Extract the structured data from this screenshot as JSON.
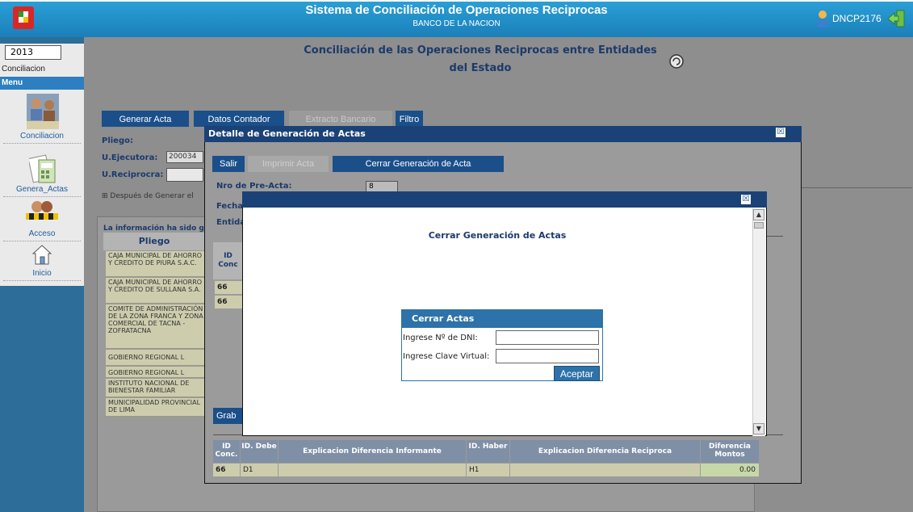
{
  "header": {
    "title": "Sistema de Conciliación de Operaciones Reciprocas",
    "subtitle": "BANCO DE LA NACION",
    "user": "DNCP2176"
  },
  "sidebar": {
    "year": "2013",
    "section": "Conciliacion",
    "menu_label": "Menu",
    "items": [
      {
        "label": "Conciliacion",
        "icon": "meeting-people-icon"
      },
      {
        "label": "Genera_Actas",
        "icon": "document-calculator-icon"
      },
      {
        "label": "Acceso",
        "icon": "restricted-access-icon"
      },
      {
        "label": "Inicio",
        "icon": "home-icon"
      }
    ]
  },
  "main": {
    "title": "Conciliación de las Operaciones Reciprocas entre Entidades del Estado",
    "tabs": [
      "Generar Acta",
      "Datos Contador",
      "Extracto Bancario",
      "Filtro"
    ],
    "pliego_label": "Pliego:",
    "ejecutora_label": "U.Ejecutora:",
    "ejecutora_value": "200034",
    "reciprocra_label": "U.Reciprocra:",
    "despues_text": "⊞ Después de Generar el",
    "info_header": "La información ha sido g",
    "pliego_column": "Pliego",
    "pliego_rows": [
      "CAJA MUNICIPAL DE AHORRO Y CREDITO DE PIURA S.A.C.",
      "CAJA MUNICIPAL DE AHORRO Y CREDITO DE SULLANA S.A.",
      "COMITE DE ADMINISTRACIÓN DE LA ZONA FRANCA Y ZONA COMERCIAL DE TACNA - ZOFRATACNA",
      "GOBIERNO REGIONAL L",
      "GOBIERNO REGIONAL L",
      "INSTITUTO NACIONAL DE BIENESTAR FAMILIAR",
      "MUNICIPALIDAD PROVINCIAL DE LIMA"
    ]
  },
  "modal_detalle": {
    "title": "Detalle de Generación de Actas",
    "close": "☒",
    "buttons": [
      "Salir",
      "Imprimir Acta",
      "Cerrar Generación de Acta"
    ],
    "nro_label": "Nro de Pre-Acta:",
    "nro_value": "8",
    "fecha_label": "Fecha",
    "entidad_label": "Entida",
    "id_header": "ID Conc",
    "id_rows": [
      "66",
      "66"
    ],
    "grabar_label": "Grab",
    "table": {
      "headers": [
        "ID Conc.",
        "ID. Debe",
        "Explicacion Diferencia Informante",
        "ID. Haber",
        "Explicacion Diferencia Reciproca",
        "Diferencia Montos"
      ],
      "row": [
        "66",
        "D1",
        "",
        "H1",
        "",
        "0.00"
      ]
    }
  },
  "modal_cerrar": {
    "close": "☒",
    "title": "Cerrar Generación de Actas",
    "panel_title": "Cerrar Actas",
    "dni_label": "Ingrese Nº de DNI:",
    "clave_label": "Ingrese Clave Virtual:",
    "submit": "Aceptar"
  }
}
